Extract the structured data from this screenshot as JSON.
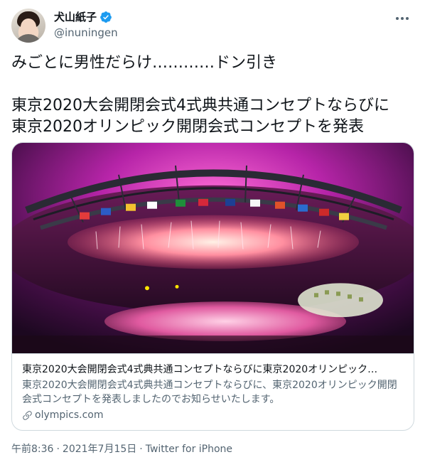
{
  "author": {
    "display_name": "犬山紙子",
    "handle": "@inuningen",
    "verified": true,
    "avatar_icon": "avatar-photo"
  },
  "tweet": {
    "line1": "みごとに男性だらけ…………ドン引き",
    "line2": "東京2020大会開閉会式4式典共通コンセプトならびに",
    "line3": "東京2020オリンピック開閉会式コンセプトを発表"
  },
  "card": {
    "title": "東京2020大会開閉会式4式典共通コンセプトならびに東京2020オリンピック…",
    "description": "東京2020大会開閉会式4式典共通コンセプトならびに、東京2020オリンピック開閉会式コンセプトを発表しましたのでお知らせいたします。",
    "domain": "olympics.com",
    "image_subject": "stadium-fireworks-photo"
  },
  "meta": {
    "time": "午前8:36",
    "date": "2021年7月15日",
    "source": "Twitter for iPhone",
    "separator": "·"
  },
  "colors": {
    "text_primary": "#0f1419",
    "text_secondary": "#536471",
    "border": "#cfd9de",
    "verified_blue": "#1d9bf0"
  }
}
